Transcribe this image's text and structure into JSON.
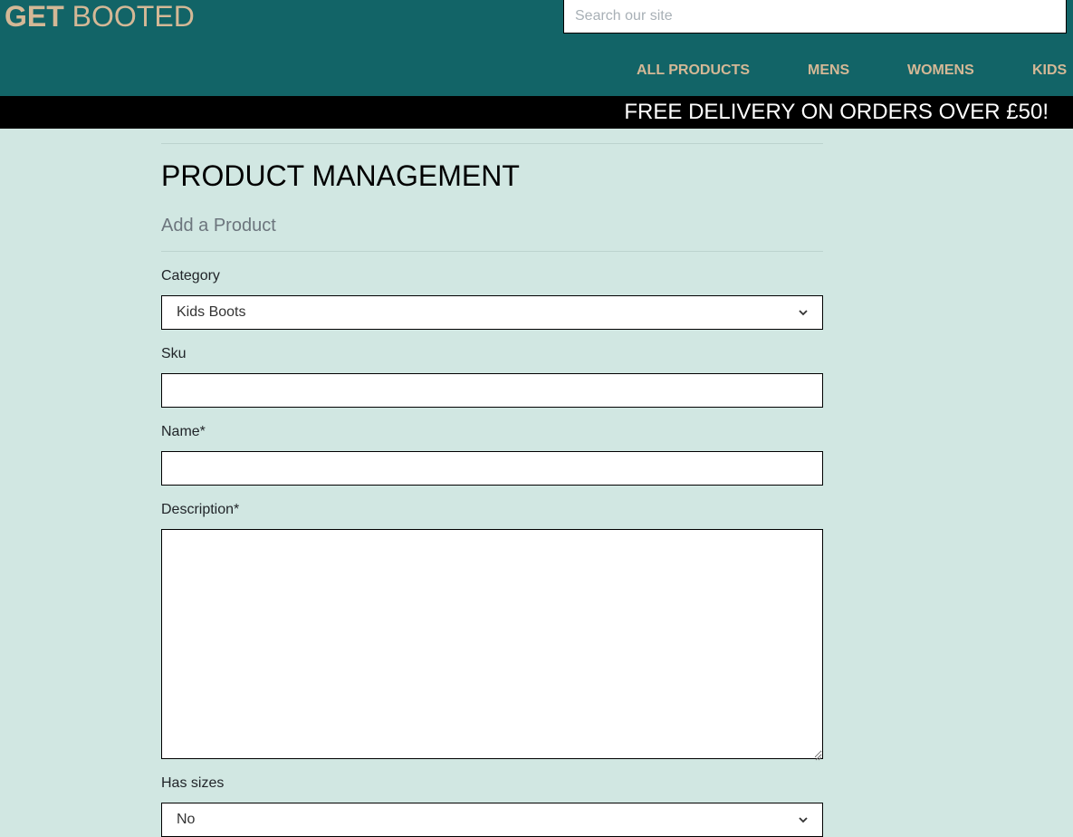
{
  "header": {
    "logo_bold": "GET",
    "logo_light": "BOOTED",
    "search_placeholder": "Search our site",
    "nav": {
      "all_products": "ALL PRODUCTS",
      "mens": "MENS",
      "womens": "WOMENS",
      "kids": "KIDS"
    }
  },
  "banner": {
    "text": "FREE DELIVERY ON ORDERS OVER £50!"
  },
  "page": {
    "title": "PRODUCT MANAGEMENT",
    "subtitle": "Add a Product"
  },
  "form": {
    "category_label": "Category",
    "category_value": "Kids Boots",
    "sku_label": "Sku",
    "sku_value": "",
    "name_label": "Name*",
    "name_value": "",
    "description_label": "Description*",
    "description_value": "",
    "has_sizes_label": "Has sizes",
    "has_sizes_value": "No"
  },
  "icons": {
    "select_chevron": "chevron-down-icon",
    "resize": "resize-grip-icon"
  },
  "colors": {
    "header_bg": "#126467",
    "accent": "#d4b896",
    "page_bg": "#d1e7e2",
    "banner_bg": "#000000"
  }
}
